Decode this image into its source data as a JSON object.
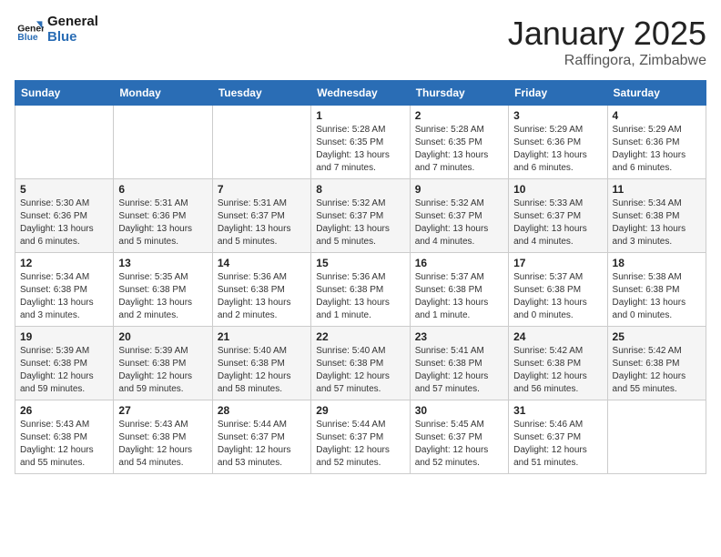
{
  "logo": {
    "line1": "General",
    "line2": "Blue"
  },
  "title": "January 2025",
  "location": "Raffingora, Zimbabwe",
  "days_of_week": [
    "Sunday",
    "Monday",
    "Tuesday",
    "Wednesday",
    "Thursday",
    "Friday",
    "Saturday"
  ],
  "weeks": [
    [
      {
        "day": "",
        "info": ""
      },
      {
        "day": "",
        "info": ""
      },
      {
        "day": "",
        "info": ""
      },
      {
        "day": "1",
        "info": "Sunrise: 5:28 AM\nSunset: 6:35 PM\nDaylight: 13 hours\nand 7 minutes."
      },
      {
        "day": "2",
        "info": "Sunrise: 5:28 AM\nSunset: 6:35 PM\nDaylight: 13 hours\nand 7 minutes."
      },
      {
        "day": "3",
        "info": "Sunrise: 5:29 AM\nSunset: 6:36 PM\nDaylight: 13 hours\nand 6 minutes."
      },
      {
        "day": "4",
        "info": "Sunrise: 5:29 AM\nSunset: 6:36 PM\nDaylight: 13 hours\nand 6 minutes."
      }
    ],
    [
      {
        "day": "5",
        "info": "Sunrise: 5:30 AM\nSunset: 6:36 PM\nDaylight: 13 hours\nand 6 minutes."
      },
      {
        "day": "6",
        "info": "Sunrise: 5:31 AM\nSunset: 6:36 PM\nDaylight: 13 hours\nand 5 minutes."
      },
      {
        "day": "7",
        "info": "Sunrise: 5:31 AM\nSunset: 6:37 PM\nDaylight: 13 hours\nand 5 minutes."
      },
      {
        "day": "8",
        "info": "Sunrise: 5:32 AM\nSunset: 6:37 PM\nDaylight: 13 hours\nand 5 minutes."
      },
      {
        "day": "9",
        "info": "Sunrise: 5:32 AM\nSunset: 6:37 PM\nDaylight: 13 hours\nand 4 minutes."
      },
      {
        "day": "10",
        "info": "Sunrise: 5:33 AM\nSunset: 6:37 PM\nDaylight: 13 hours\nand 4 minutes."
      },
      {
        "day": "11",
        "info": "Sunrise: 5:34 AM\nSunset: 6:38 PM\nDaylight: 13 hours\nand 3 minutes."
      }
    ],
    [
      {
        "day": "12",
        "info": "Sunrise: 5:34 AM\nSunset: 6:38 PM\nDaylight: 13 hours\nand 3 minutes."
      },
      {
        "day": "13",
        "info": "Sunrise: 5:35 AM\nSunset: 6:38 PM\nDaylight: 13 hours\nand 2 minutes."
      },
      {
        "day": "14",
        "info": "Sunrise: 5:36 AM\nSunset: 6:38 PM\nDaylight: 13 hours\nand 2 minutes."
      },
      {
        "day": "15",
        "info": "Sunrise: 5:36 AM\nSunset: 6:38 PM\nDaylight: 13 hours\nand 1 minute."
      },
      {
        "day": "16",
        "info": "Sunrise: 5:37 AM\nSunset: 6:38 PM\nDaylight: 13 hours\nand 1 minute."
      },
      {
        "day": "17",
        "info": "Sunrise: 5:37 AM\nSunset: 6:38 PM\nDaylight: 13 hours\nand 0 minutes."
      },
      {
        "day": "18",
        "info": "Sunrise: 5:38 AM\nSunset: 6:38 PM\nDaylight: 13 hours\nand 0 minutes."
      }
    ],
    [
      {
        "day": "19",
        "info": "Sunrise: 5:39 AM\nSunset: 6:38 PM\nDaylight: 12 hours\nand 59 minutes."
      },
      {
        "day": "20",
        "info": "Sunrise: 5:39 AM\nSunset: 6:38 PM\nDaylight: 12 hours\nand 59 minutes."
      },
      {
        "day": "21",
        "info": "Sunrise: 5:40 AM\nSunset: 6:38 PM\nDaylight: 12 hours\nand 58 minutes."
      },
      {
        "day": "22",
        "info": "Sunrise: 5:40 AM\nSunset: 6:38 PM\nDaylight: 12 hours\nand 57 minutes."
      },
      {
        "day": "23",
        "info": "Sunrise: 5:41 AM\nSunset: 6:38 PM\nDaylight: 12 hours\nand 57 minutes."
      },
      {
        "day": "24",
        "info": "Sunrise: 5:42 AM\nSunset: 6:38 PM\nDaylight: 12 hours\nand 56 minutes."
      },
      {
        "day": "25",
        "info": "Sunrise: 5:42 AM\nSunset: 6:38 PM\nDaylight: 12 hours\nand 55 minutes."
      }
    ],
    [
      {
        "day": "26",
        "info": "Sunrise: 5:43 AM\nSunset: 6:38 PM\nDaylight: 12 hours\nand 55 minutes."
      },
      {
        "day": "27",
        "info": "Sunrise: 5:43 AM\nSunset: 6:38 PM\nDaylight: 12 hours\nand 54 minutes."
      },
      {
        "day": "28",
        "info": "Sunrise: 5:44 AM\nSunset: 6:37 PM\nDaylight: 12 hours\nand 53 minutes."
      },
      {
        "day": "29",
        "info": "Sunrise: 5:44 AM\nSunset: 6:37 PM\nDaylight: 12 hours\nand 52 minutes."
      },
      {
        "day": "30",
        "info": "Sunrise: 5:45 AM\nSunset: 6:37 PM\nDaylight: 12 hours\nand 52 minutes."
      },
      {
        "day": "31",
        "info": "Sunrise: 5:46 AM\nSunset: 6:37 PM\nDaylight: 12 hours\nand 51 minutes."
      },
      {
        "day": "",
        "info": ""
      }
    ]
  ]
}
